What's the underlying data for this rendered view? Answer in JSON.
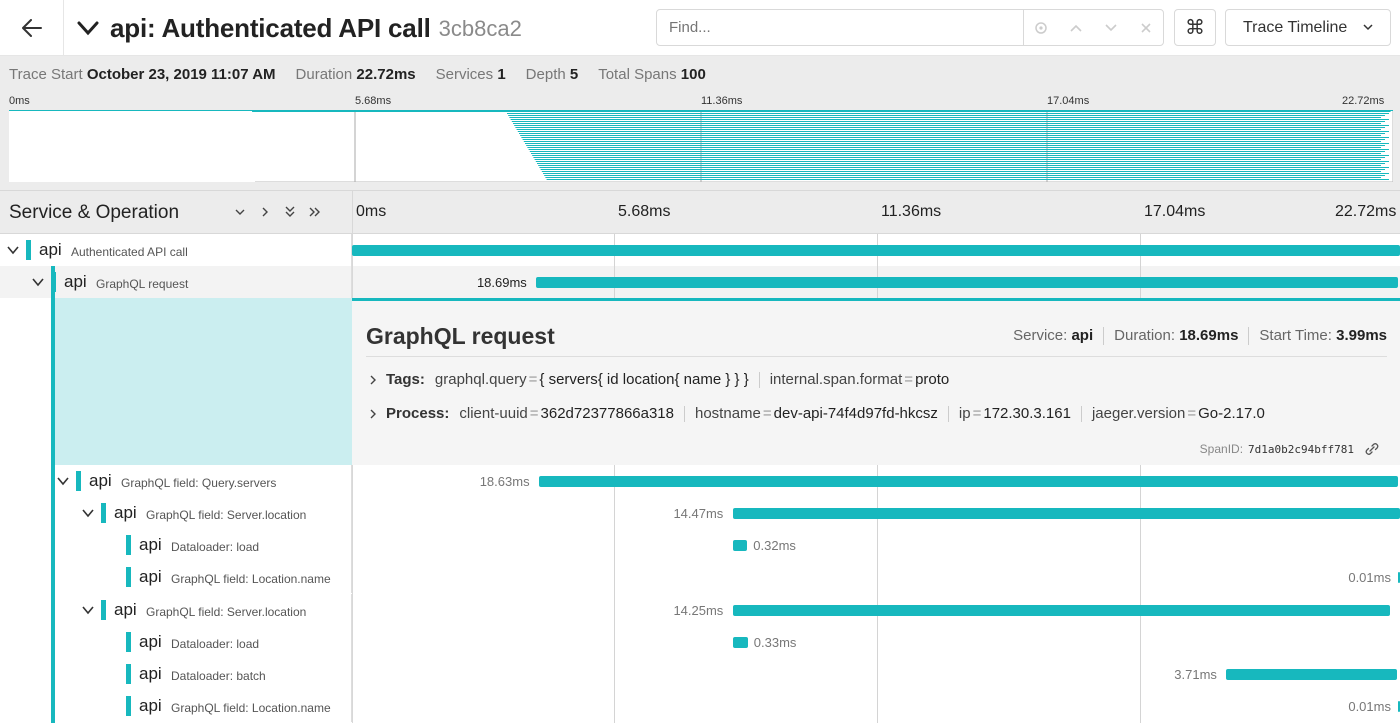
{
  "header": {
    "title": "api: Authenticated API call",
    "trace_id": "3cb8ca2",
    "find_placeholder": "Find...",
    "keyboard_shortcut_glyph": "⌘",
    "view_label": "Trace Timeline"
  },
  "meta": {
    "trace_start_label": "Trace Start",
    "trace_start": "October 23, 2019 11:07 AM",
    "duration_label": "Duration",
    "duration": "22.72ms",
    "services_label": "Services",
    "services": "1",
    "depth_label": "Depth",
    "depth": "5",
    "total_spans_label": "Total Spans",
    "total_spans": "100"
  },
  "minimap": {
    "ticks": [
      "0ms",
      "5.68ms",
      "11.36ms",
      "17.04ms",
      "22.72ms"
    ]
  },
  "timeline": {
    "service_operation_label": "Service & Operation",
    "ticks": [
      "0ms",
      "5.68ms",
      "11.36ms",
      "17.04ms",
      "22.72ms"
    ],
    "total_ms": 22.72
  },
  "spans": [
    {
      "service": "api",
      "operation": "Authenticated API call",
      "start_ms": 0.0,
      "duration_ms": 22.72,
      "duration_label": ""
    },
    {
      "service": "api",
      "operation": "GraphQL request",
      "start_ms": 3.99,
      "duration_ms": 18.69,
      "duration_label": "18.69ms"
    },
    {
      "service": "api",
      "operation": "GraphQL field: Query.servers",
      "start_ms": 4.05,
      "duration_ms": 18.63,
      "duration_label": "18.63ms"
    },
    {
      "service": "api",
      "operation": "GraphQL field: Server.location",
      "start_ms": 8.25,
      "duration_ms": 14.47,
      "duration_label": "14.47ms"
    },
    {
      "service": "api",
      "operation": "Dataloader: load",
      "start_ms": 8.25,
      "duration_ms": 0.32,
      "duration_label": "0.32ms"
    },
    {
      "service": "api",
      "operation": "GraphQL field: Location.name",
      "start_ms": 22.68,
      "duration_ms": 0.01,
      "duration_label": "0.01ms"
    },
    {
      "service": "api",
      "operation": "GraphQL field: Server.location",
      "start_ms": 8.25,
      "duration_ms": 14.25,
      "duration_label": "14.25ms"
    },
    {
      "service": "api",
      "operation": "Dataloader: load",
      "start_ms": 8.25,
      "duration_ms": 0.33,
      "duration_label": "0.33ms"
    },
    {
      "service": "api",
      "operation": "Dataloader: batch",
      "start_ms": 18.95,
      "duration_ms": 3.71,
      "duration_label": "3.71ms"
    },
    {
      "service": "api",
      "operation": "GraphQL field: Location.name",
      "start_ms": 22.68,
      "duration_ms": 0.01,
      "duration_label": "0.01ms"
    }
  ],
  "detail": {
    "title": "GraphQL request",
    "service_label": "Service:",
    "service": "api",
    "duration_label": "Duration:",
    "duration": "18.69ms",
    "start_label": "Start Time:",
    "start": "3.99ms",
    "tags_label": "Tags:",
    "tags": [
      {
        "key": "graphql.query",
        "value": "{ servers{ id location{ name } } }"
      },
      {
        "key": "internal.span.format",
        "value": "proto"
      }
    ],
    "process_label": "Process:",
    "process": [
      {
        "key": "client-uuid",
        "value": "362d72377866a318"
      },
      {
        "key": "hostname",
        "value": "dev-api-74f4d97fd-hkcsz"
      },
      {
        "key": "ip",
        "value": "172.30.3.161"
      },
      {
        "key": "jaeger.version",
        "value": "Go-2.17.0"
      }
    ],
    "span_id_label": "SpanID:",
    "span_id": "7d1a0b2c94bff781"
  },
  "colors": {
    "accent": "#17b8be",
    "detail_bg": "#cbeef0"
  }
}
